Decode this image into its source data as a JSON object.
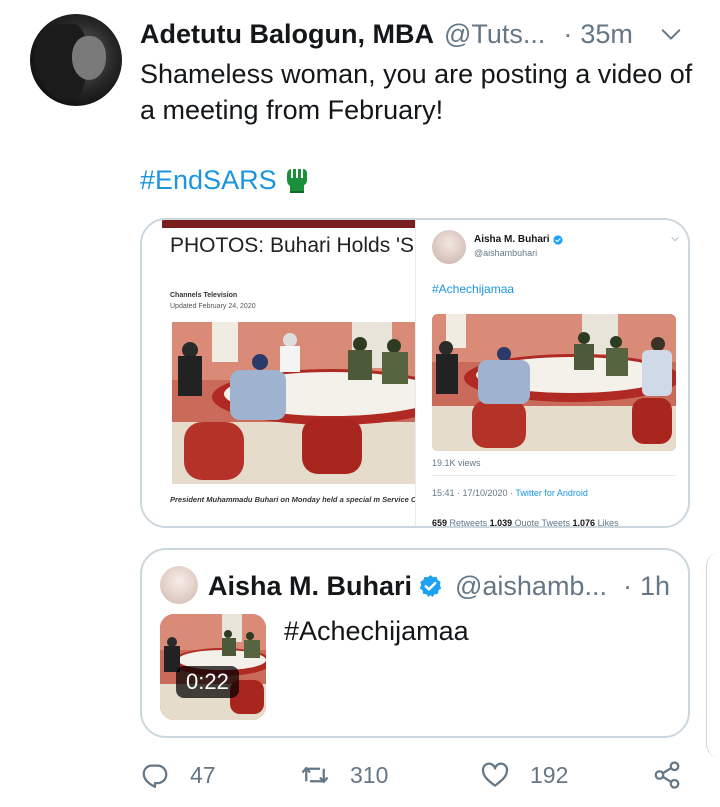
{
  "tweet": {
    "author_name": "Adetutu Balogun, MBA",
    "author_handle": "@Tuts...",
    "separator": "·",
    "time": "35m",
    "text": "Shameless woman, you are posting a video of a meeting from February!",
    "hashtag": "#EndSARS"
  },
  "media": {
    "article": {
      "title": "PHOTOS: Buhari Holds 'Sp Chiefs, IGP",
      "source": "Channels Television",
      "updated": "Updated February 24, 2020",
      "caption": "President Muhammadu Buhari on Monday held a special m Service Chiefs and the Inspector-General of Police."
    },
    "screenshot": {
      "name": "Aisha M. Buhari",
      "handle": "@aishambuhari",
      "hashtag": "#Achechijamaa",
      "views": "19.1K views",
      "time": "15:41 · 17/10/2020 · ",
      "app": "Twitter for Android",
      "retweets_count": "659",
      "retweets_label": "Retweets",
      "quotes_count": "1,039",
      "quotes_label": "Quote Tweets",
      "likes_count": "1,076",
      "likes_label": "Likes"
    }
  },
  "quote": {
    "name": "Aisha M. Buhari",
    "handle": "@aishamb...",
    "separator": "·",
    "time": "1h",
    "text": "#Achechijamaa",
    "duration": "0:22"
  },
  "actions": {
    "replies": "47",
    "retweets": "310",
    "likes": "192"
  },
  "colors": {
    "link": "#1b95e0",
    "muted": "#657786",
    "text": "#14171a",
    "border": "#ccd6dd"
  },
  "icons": [
    "chevron-down-icon",
    "fist-icon",
    "verified-icon",
    "reply-icon",
    "retweet-icon",
    "like-icon",
    "share-icon"
  ]
}
